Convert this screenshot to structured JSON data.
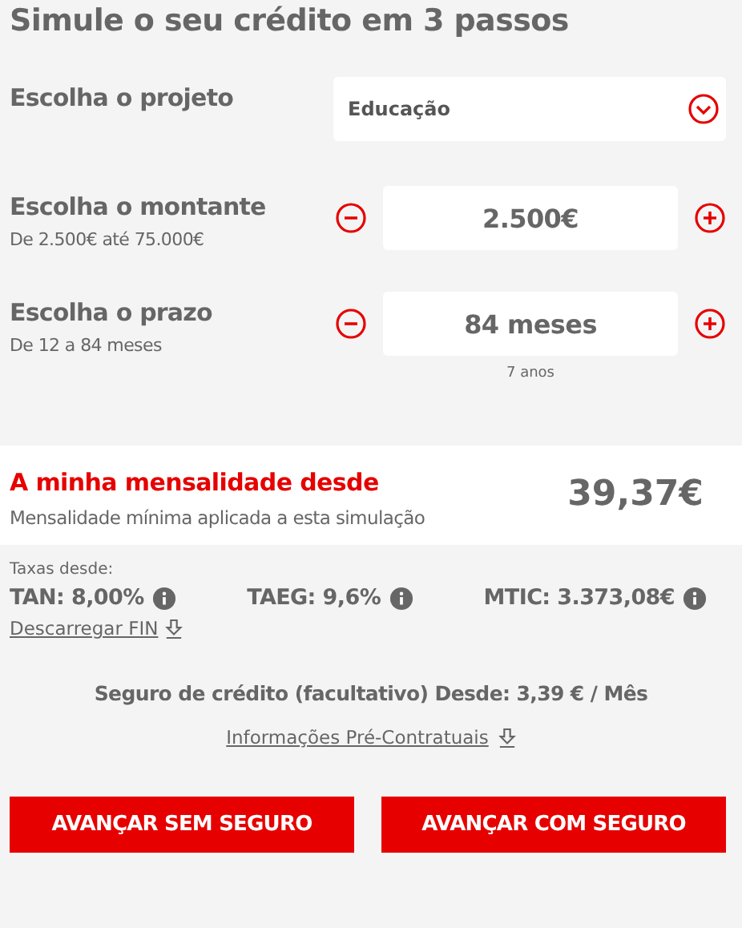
{
  "title": "Simule o seu crédito em 3 passos",
  "project": {
    "label": "Escolha o projeto",
    "value": "Educação"
  },
  "steppers": [
    {
      "label": "Escolha o montante",
      "hint": "De 2.500€ até 75.000€",
      "value": "2.500€"
    },
    {
      "label": "Escolha o prazo",
      "hint": "De 12 a 84 meses",
      "value": "84 meses",
      "note": "7 anos"
    }
  ],
  "monthly": {
    "title": "A minha mensalidade desde",
    "subtitle": "Mensalidade mínima aplicada a esta simulação",
    "amount": "39,37€"
  },
  "rates": {
    "caption": "Taxas desde:",
    "items": [
      "TAN: 8,00%",
      "TAEG: 9,6%",
      "MTIC: 3.373,08€"
    ],
    "link": "Descarregar FIN"
  },
  "insurance": {
    "text": "Seguro de crédito (facultativo) Desde: 3,39 € / Mês",
    "link": "Informações Pré-Contratuais"
  },
  "buttons": [
    "AVANÇAR SEM SEGURO",
    "AVANÇAR COM SEGURO"
  ]
}
